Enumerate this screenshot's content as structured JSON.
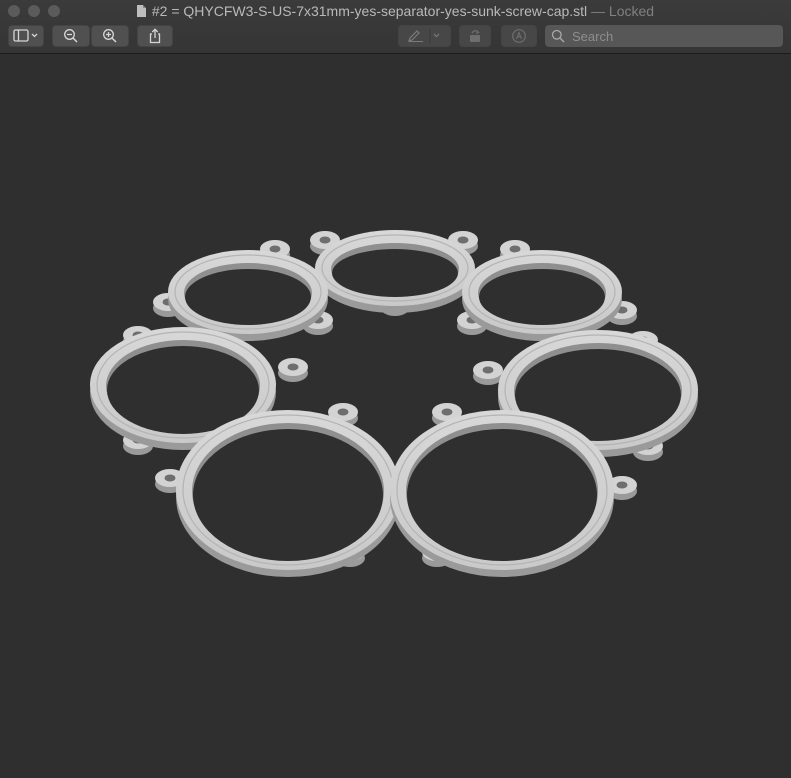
{
  "window": {
    "title": "#2 = QHYCFW3-S-US-7x31mm-yes-separator-yes-sunk-screw-cap.stl",
    "status": "— Locked"
  },
  "toolbar": {
    "sidebar_icon": "sidebar-toggle-icon",
    "zoom_out_icon": "zoom-out-icon",
    "zoom_in_icon": "zoom-in-icon",
    "share_icon": "share-icon",
    "markup_icon": "pen-markup-icon",
    "rotate_icon": "rotate-icon",
    "annotate_icon": "annotate-icon"
  },
  "search": {
    "placeholder": "Search",
    "value": ""
  },
  "model": {
    "filename": "QHYCFW3-S-US-7x31mm-yes-separator-yes-sunk-screw-cap.stl",
    "ring_count": 7,
    "colors": {
      "ring": "#c9c9c9",
      "ring_shade": "#9a9a9a",
      "background": "#2f2f2f"
    }
  }
}
